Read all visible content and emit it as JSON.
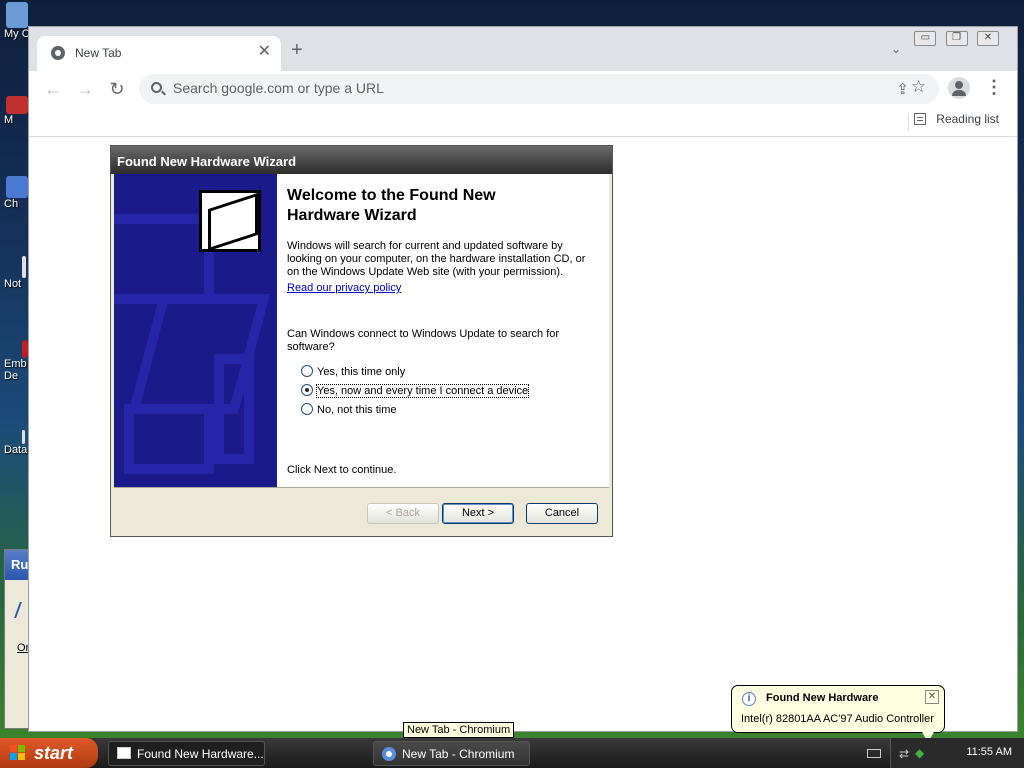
{
  "desktop": {
    "icons": [
      {
        "label": "My C",
        "color": "#6c9cd8"
      },
      {
        "label": "M",
        "color": "#c03030"
      },
      {
        "label": "Ch",
        "color": "#4a7ad0"
      },
      {
        "label": "Not",
        "color": "#e0e0e0"
      },
      {
        "label": "Emb De",
        "color": "#c02020"
      },
      {
        "label": "Data",
        "color": "#e0e0e0"
      }
    ],
    "run_dialog_fragment": {
      "title": "Ru",
      "link": "Or"
    }
  },
  "browser": {
    "tab": {
      "title": "New Tab",
      "close_glyph": "✕"
    },
    "new_tab_glyph": "+",
    "tab_search_glyph": "⌄",
    "window_controls": {
      "minimize": "▭",
      "restore": "❐",
      "close": "✕"
    },
    "toolbar": {
      "back_glyph": "←",
      "forward_glyph": "→",
      "reload_glyph": "↻",
      "omnibox_placeholder": "Search google.com or type a URL",
      "share_glyph": "⇪",
      "star_glyph": "☆",
      "menu_glyph": "⋮"
    },
    "bookmarks_bar": {
      "reading_list_label": "Reading list"
    }
  },
  "wizard": {
    "title": "Found New Hardware Wizard",
    "heading": "Welcome to the Found New Hardware Wizard",
    "intro": "Windows will search for current and updated software by looking on your computer, on the hardware installation CD, or on the Windows Update Web site (with your permission).",
    "privacy_link": "Read our privacy policy",
    "question": "Can Windows connect to Windows Update to search for software?",
    "options": [
      {
        "label": "Yes, this time only",
        "checked": false
      },
      {
        "label": "Yes, now and every time I connect a device",
        "checked": true
      },
      {
        "label": "No, not this time",
        "checked": false
      }
    ],
    "continue_text": "Click Next to continue.",
    "buttons": {
      "back": "< Back",
      "next": "Next >",
      "cancel": "Cancel"
    }
  },
  "tooltip": {
    "text": "New Tab - Chromium"
  },
  "balloon": {
    "title": "Found New Hardware",
    "text": "Intel(r) 82801AA AC'97 Audio Controller",
    "close_glyph": "✕",
    "info_glyph": "i"
  },
  "taskbar": {
    "start_label": "start",
    "buttons": [
      {
        "label": "Found New Hardware...",
        "active": true
      },
      {
        "label": "New Tab - Chromium",
        "active": false
      }
    ],
    "clock": "11:55 AM"
  },
  "colors": {
    "wizard_side_panel": "#1a1a8a",
    "start_button": "#d04a1a",
    "balloon_bg": "#ffffe1",
    "link": "#0000cc"
  }
}
